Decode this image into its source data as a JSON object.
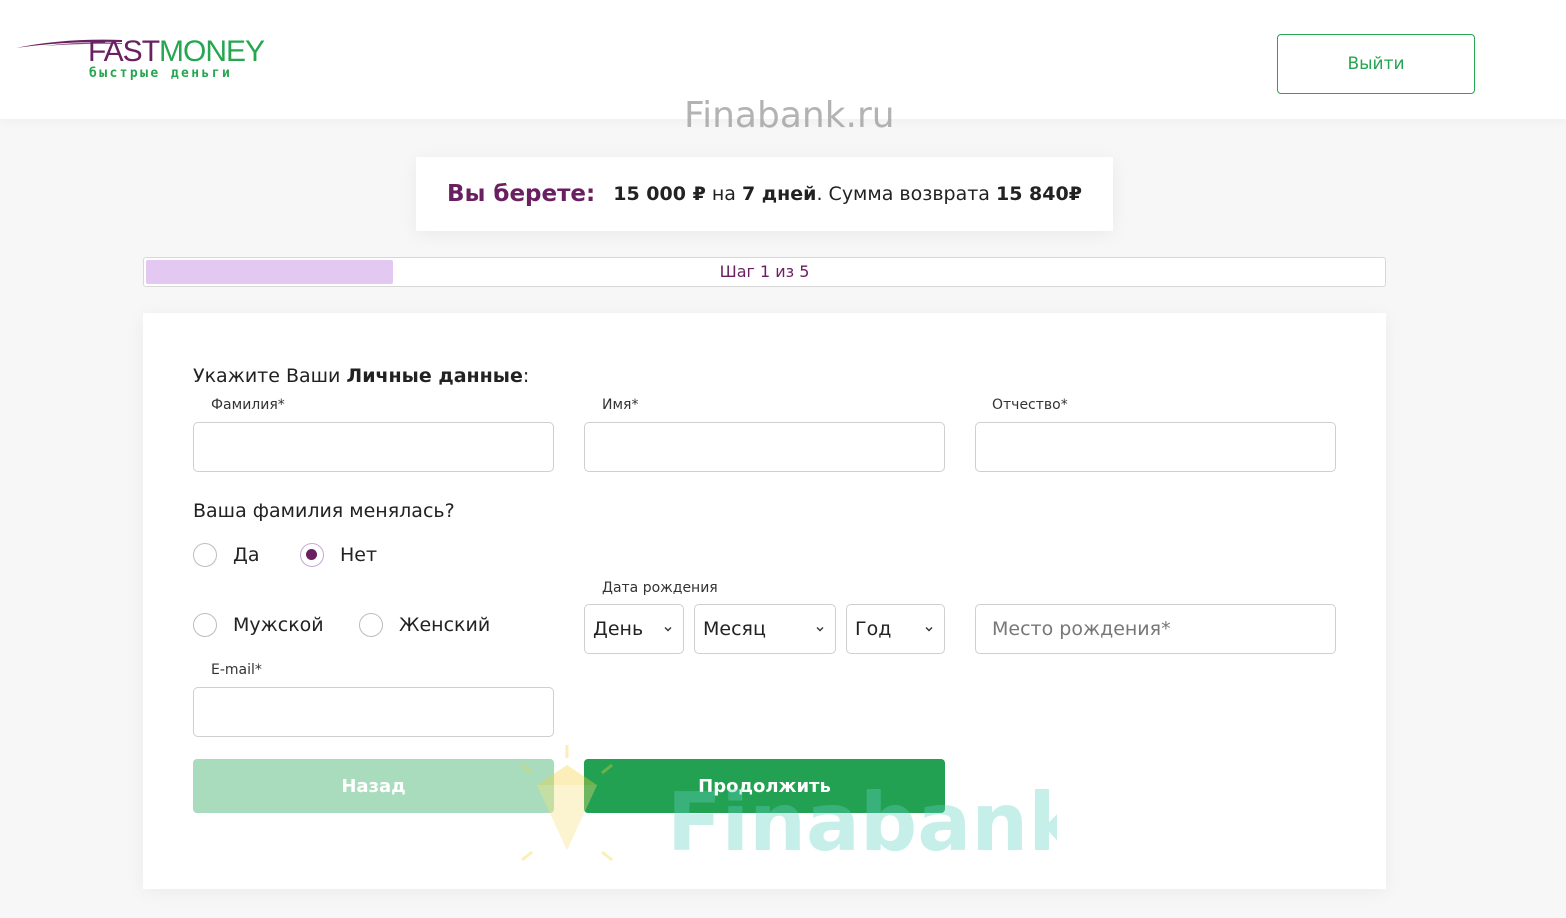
{
  "header": {
    "logo": {
      "brand_part1": "FAST",
      "brand_part2": "MONEY",
      "tagline": "быстрые деньги"
    },
    "logout_label": "Выйти"
  },
  "watermark": {
    "top_text": "Finabank.ru",
    "bottom_text": "Finabank"
  },
  "summary": {
    "lead": "Вы берете:",
    "amount": "15 000 ₽",
    "on": " на ",
    "term": "7 дней",
    "return_text": ". Сумма возврата ",
    "return_amount": "15 840₽"
  },
  "progress": {
    "label": "Шаг 1 из 5",
    "fraction": 0.2,
    "fill_color": "#e3c8f2"
  },
  "form": {
    "instruction_prefix": "Укажите Ваши ",
    "instruction_bold": "Личные данные",
    "instruction_suffix": ":",
    "surname": {
      "label": "Фамилия*",
      "value": ""
    },
    "name": {
      "label": "Имя*",
      "value": ""
    },
    "patronymic": {
      "label": "Отчество*",
      "value": ""
    },
    "surname_changed": {
      "question": "Ваша фамилия менялась?",
      "options": [
        {
          "label": "Да",
          "checked": false
        },
        {
          "label": "Нет",
          "checked": true
        }
      ]
    },
    "gender": {
      "options": [
        {
          "label": "Мужской",
          "checked": false
        },
        {
          "label": "Женский",
          "checked": false
        }
      ]
    },
    "birthdate": {
      "label": "Дата рождения",
      "day": "День",
      "month": "Месяц",
      "year": "Год"
    },
    "birthplace": {
      "placeholder": "Место рождения*"
    },
    "email": {
      "label": "E-mail*",
      "value": ""
    },
    "back_label": "Назад",
    "continue_label": "Продолжить"
  },
  "colors": {
    "brand_purple": "#6a2060",
    "brand_green": "#26a650",
    "button_green": "#23a152"
  }
}
